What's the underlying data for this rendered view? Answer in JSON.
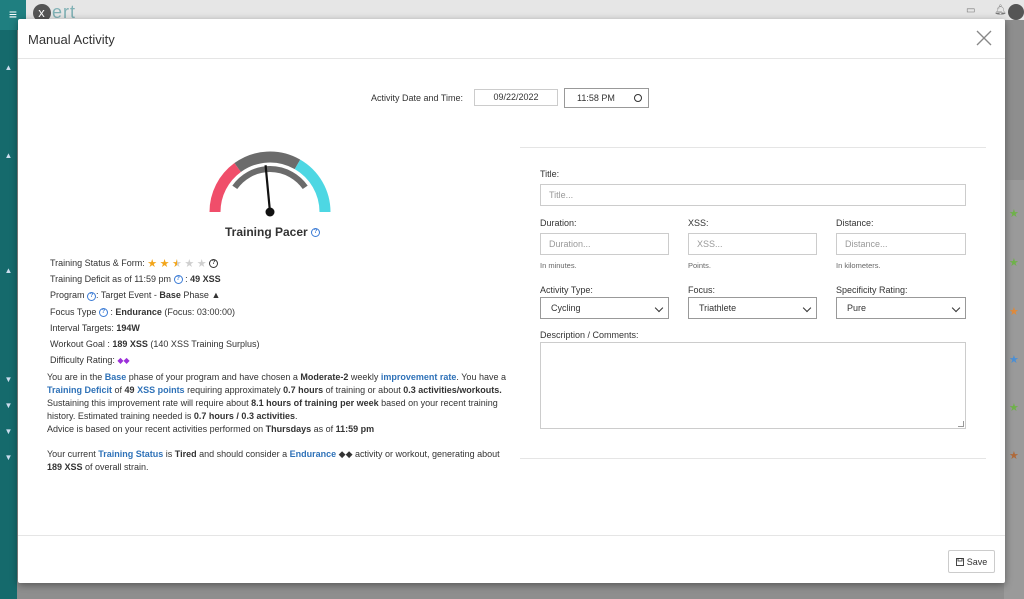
{
  "app": {
    "logo_text": "ert"
  },
  "modal": {
    "title": "Manual Activity",
    "save_label": "Save"
  },
  "datetime": {
    "label": "Activity Date and Time:",
    "date": "09/22/2022",
    "time": "11:58 PM"
  },
  "pacer": {
    "title": "Training Pacer",
    "needle_fraction": 0.47,
    "colors": {
      "red": "#f04e6a",
      "gray": "#6b6b6b",
      "cyan": "#4dd7e3"
    }
  },
  "stats": {
    "status_label": "Training Status & Form:",
    "status_stars": 2.5,
    "status_max": 5,
    "deficit_label": "Training Deficit as of 11:59 pm",
    "deficit_value": "49 XSS",
    "program_label": "Program",
    "program_text": ": Target Event - ",
    "program_phase": "Base",
    "program_suffix": " Phase",
    "focus_label": "Focus Type",
    "focus_value": "Endurance",
    "focus_detail": "(Focus: 03:00:00)",
    "interval_label": "Interval Targets:",
    "interval_value": "194W",
    "goal_label": "Workout Goal :",
    "goal_value": "189 XSS",
    "goal_detail": "(140 XSS Training Surplus)",
    "difficulty_label": "Difficulty Rating:",
    "difficulty_value": "◆◆"
  },
  "advice": {
    "p1": {
      "a": "You are in the ",
      "b": "Base",
      "c": " phase of your program and have chosen a ",
      "d": "Moderate-2",
      "e": " weekly ",
      "f": "improvement rate",
      "g": ". You have a ",
      "h": "Training Deficit",
      "i": " of ",
      "j": "49",
      "k": "XSS points",
      "l": " requiring approximately ",
      "m": "0.7 hours",
      "n": " of training or about ",
      "o": "0.3 activities/workouts.",
      "p": " Sustaining this improvement rate will require about ",
      "q": "8.1 hours of training per week",
      "r": " based on your recent training history. Estimated training needed is ",
      "s": "0.7 hours / 0.3 activities",
      "t": ".",
      "u": "Advice is based on your recent activities performed on ",
      "v": "Thursdays",
      "w": " as of ",
      "x": "11:59 pm"
    },
    "p2": {
      "a": "Your current ",
      "b": "Training Status",
      "c": " is ",
      "d": "Tired",
      "e": " and should consider a ",
      "f": "Endurance",
      "g": " ◆◆ activity or workout, generating about ",
      "h": "189 XSS",
      "i": " of overall strain."
    }
  },
  "form": {
    "title_label": "Title:",
    "title_placeholder": "Title...",
    "duration_label": "Duration:",
    "duration_placeholder": "Duration...",
    "duration_help": "In minutes.",
    "xss_label": "XSS:",
    "xss_placeholder": "XSS...",
    "xss_help": "Points.",
    "distance_label": "Distance:",
    "distance_placeholder": "Distance...",
    "distance_help": "In kilometers.",
    "activity_type_label": "Activity Type:",
    "activity_type_value": "Cycling",
    "focus_label": "Focus:",
    "focus_value": "Triathlete",
    "specificity_label": "Specificity Rating:",
    "specificity_value": "Pure",
    "description_label": "Description / Comments:"
  }
}
